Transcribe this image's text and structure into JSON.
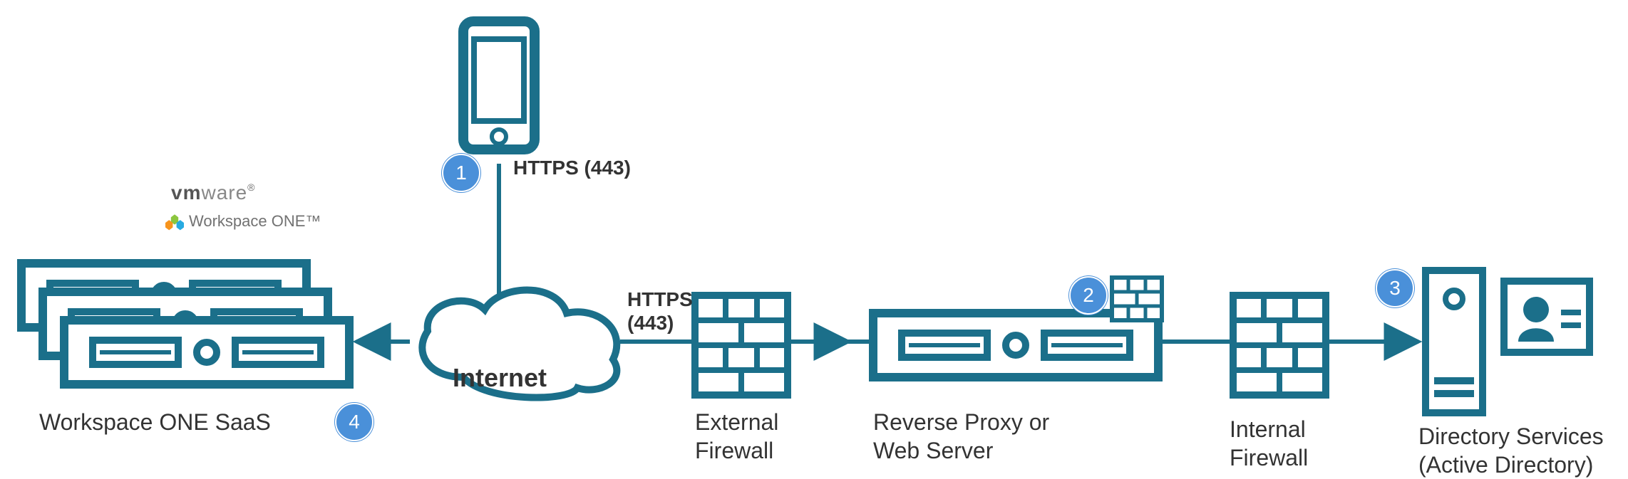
{
  "brand": {
    "vm": "vm",
    "ware": "ware",
    "reg": "®",
    "subline": "Workspace ONE™"
  },
  "nodes": {
    "saas": "Workspace ONE SaaS",
    "internet": "Internet",
    "ext_fw": "External\nFirewall",
    "reverse_proxy": "Reverse Proxy or\nWeb Server",
    "int_fw": "Internal\nFirewall",
    "directory": "Directory Services\n(Active Directory)"
  },
  "protocols": {
    "device_to_internet": "HTTPS (443)",
    "internet_to_extfw_a": "HTTPS",
    "internet_to_extfw_b": "(443)"
  },
  "badges": {
    "one": "1",
    "two": "2",
    "three": "3",
    "four": "4"
  },
  "colors": {
    "stroke": "#1b6f8a",
    "fill_light": "#ffffff",
    "badge": "#4a90d9"
  },
  "flow": [
    {
      "from": "mobile-device",
      "to": "internet-cloud",
      "label": "HTTPS (443)"
    },
    {
      "from": "internet-cloud",
      "to": "workspace-one-saas",
      "label": ""
    },
    {
      "from": "internet-cloud",
      "to": "external-firewall",
      "label": "HTTPS (443)"
    },
    {
      "from": "external-firewall",
      "to": "reverse-proxy-web-server",
      "label": ""
    },
    {
      "from": "reverse-proxy-web-server",
      "to": "internal-firewall",
      "label": ""
    },
    {
      "from": "internal-firewall",
      "to": "directory-services",
      "label": ""
    }
  ]
}
